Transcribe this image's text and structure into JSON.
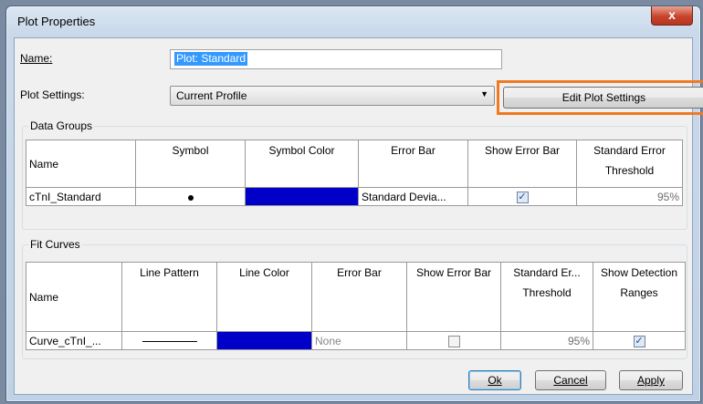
{
  "window": {
    "title": "Plot Properties",
    "close_label": "x"
  },
  "form": {
    "name_label": "Name:",
    "name_value": "Plot: Standard",
    "plot_settings_label": "Plot Settings:",
    "plot_settings_value": "Current Profile",
    "edit_button": "Edit Plot Settings"
  },
  "data_groups": {
    "title": "Data Groups",
    "headers": [
      "Name",
      "Symbol",
      "Symbol Color",
      "Error Bar",
      "Show Error Bar",
      "Standard Error Threshold"
    ],
    "rows": [
      {
        "name": "cTnI_Standard",
        "symbol": "dot",
        "color": "#0000c8",
        "error_bar": "Standard Devia...",
        "show_error_bar": true,
        "threshold": "95%"
      }
    ]
  },
  "fit_curves": {
    "title": "Fit Curves",
    "headers": [
      "Name",
      "Line Pattern",
      "Line Color",
      "Error Bar",
      "Show Error Bar",
      "Standard Er... Threshold",
      "Show Detection Ranges"
    ],
    "rows": [
      {
        "name": "Curve_cTnI_...",
        "line_pattern": "solid",
        "color": "#0000c8",
        "error_bar": "None",
        "show_error_bar": false,
        "threshold": "95%",
        "show_detection_ranges": true
      }
    ]
  },
  "buttons": {
    "ok": "Ok",
    "cancel": "Cancel",
    "apply": "Apply"
  },
  "colors": {
    "highlight": "#f07a22",
    "swatch": "#0000c8",
    "selection": "#3399ff"
  }
}
